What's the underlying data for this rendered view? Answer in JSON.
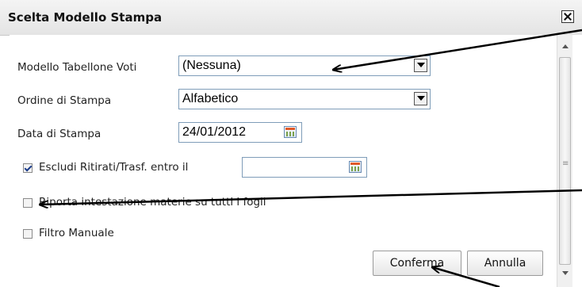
{
  "dialog": {
    "title": "Scelta Modello Stampa",
    "close_glyph": "X"
  },
  "form": {
    "modello": {
      "label": "Modello Tabellone Voti",
      "value": "(Nessuna)"
    },
    "ordine": {
      "label": "Ordine di Stampa",
      "value": "Alfabetico"
    },
    "data": {
      "label": "Data di Stampa",
      "value": "24/01/2012"
    },
    "escludi": {
      "label": "Escludi Ritirati/Trasf. entro il",
      "checked": true,
      "value": ""
    },
    "riporta": {
      "label": "Riporta intestazione materie su tutti i fogli",
      "checked": false
    },
    "filtro": {
      "label": "Filtro Manuale",
      "checked": false
    }
  },
  "buttons": {
    "confirm": "Conferma",
    "cancel": "Annulla"
  },
  "icons": {
    "calendar": "calendar-icon",
    "dropdown": "chevron-down-icon",
    "close": "close-icon"
  },
  "colors": {
    "field_border": "#7f9db9",
    "annotation_arrow": "#000000"
  }
}
